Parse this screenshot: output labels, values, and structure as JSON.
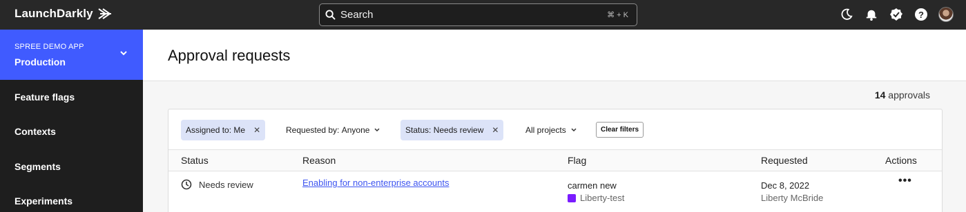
{
  "topbar": {
    "brand": "LaunchDarkly",
    "search_placeholder": "Search",
    "search_shortcut": "⌘ + K",
    "icons": [
      "moon-icon",
      "bell-icon",
      "verified-badge-icon",
      "help-icon",
      "avatar"
    ]
  },
  "sidebar": {
    "project_name": "SPREE DEMO APP",
    "environment": "Production",
    "items": [
      {
        "label": "Feature flags"
      },
      {
        "label": "Contexts"
      },
      {
        "label": "Segments"
      },
      {
        "label": "Experiments"
      }
    ]
  },
  "page": {
    "title": "Approval requests",
    "count_value": "14",
    "count_label": "approvals"
  },
  "filters": {
    "assigned": {
      "label": "Assigned to:",
      "value": "Me"
    },
    "requested_by": {
      "label": "Requested by:",
      "value": "Anyone"
    },
    "status": {
      "label": "Status:",
      "value": "Needs review"
    },
    "projects": {
      "label": "All projects"
    },
    "clear_label": "Clear filters"
  },
  "table": {
    "columns": [
      "Status",
      "Reason",
      "Flag",
      "Requested",
      "Actions"
    ],
    "rows": [
      {
        "status": "Needs review",
        "reason": "Enabling for non-enterprise accounts",
        "flag_name": "carmen new",
        "flag_project": "Liberty-test",
        "requested_date": "Dec 8, 2022",
        "requested_by": "Liberty McBride",
        "actions": "•••"
      }
    ]
  },
  "colors": {
    "topbar_bg": "#282828",
    "sidebar_bg": "#1e1e1e",
    "accent": "#405bff",
    "chip_active": "#dce3f8",
    "project_swatch": "#7a1cff"
  }
}
